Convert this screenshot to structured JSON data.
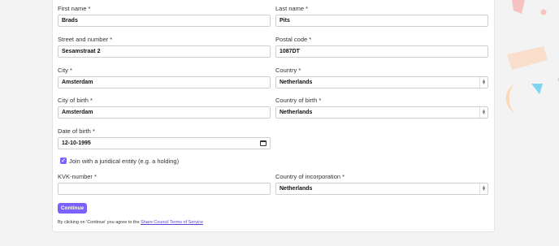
{
  "form": {
    "first_name": {
      "label": "First name *",
      "value": "Brads"
    },
    "last_name": {
      "label": "Last name *",
      "value": "Pits"
    },
    "street": {
      "label": "Street and number *",
      "value": "Sesamstraat 2"
    },
    "postal": {
      "label": "Postal code *",
      "value": "1087DT"
    },
    "city": {
      "label": "City *",
      "value": "Amsterdam"
    },
    "country": {
      "label": "Country *",
      "value": "Netherlands"
    },
    "city_birth": {
      "label": "City of birth *",
      "value": "Amsterdam"
    },
    "country_birth": {
      "label": "Country of birth *",
      "value": "Netherlands"
    },
    "dob": {
      "label": "Date of birth *",
      "value": "12-10-1995"
    },
    "juridical": {
      "label": "Join with a juridical entity (e.g. a holding)",
      "checked": true
    },
    "kvk": {
      "label": "KVK-number *",
      "value": ""
    },
    "country_incorp": {
      "label": "Country of incorporation *",
      "value": "Netherlands"
    }
  },
  "continue_label": "Continue",
  "terms": {
    "prefix": "By clicking on 'Continue' you agree to the ",
    "link": "Share Council Terms of Service"
  },
  "colors": {
    "accent": "#7b61ff",
    "deco_pink": "#f6c3c0",
    "deco_peach": "#f9ddc7",
    "deco_blue": "#7fd3ee",
    "deco_orange": "#fbd9b8"
  },
  "icons": {
    "checkbox": "checkmark-icon",
    "select": "chevron-updown-icon",
    "date": "calendar-icon"
  }
}
